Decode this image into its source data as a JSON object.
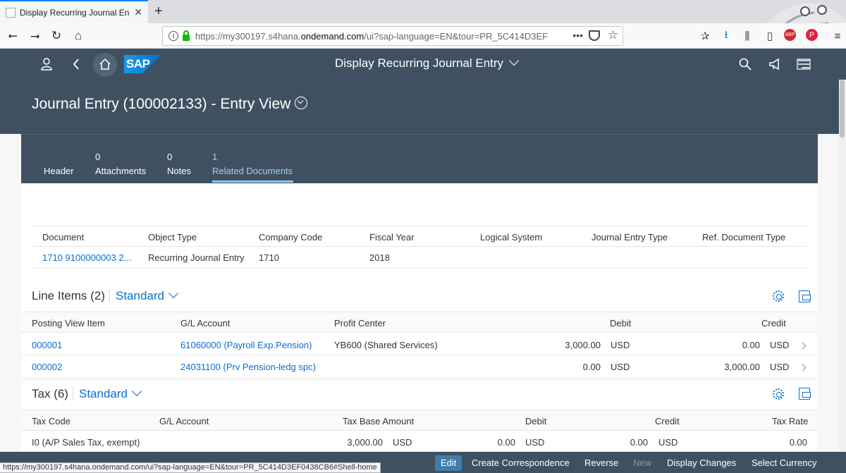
{
  "browser": {
    "tab_title": "Display Recurring Journal Entry",
    "url_prefix": "https://my300197.s4hana.",
    "url_domain": "ondemand.com",
    "url_suffix": "/ui?sap-language=EN&tour=PR_5C414D3EF",
    "status_url": "https://my300197.s4hana.ondemand.com/ui?sap-language=EN&tour=PR_5C414D3EF0438CB6#Shell-home",
    "more_glyph": "•••"
  },
  "shell": {
    "logo": "SAP",
    "title": "Display Recurring Journal Entry"
  },
  "object_header": {
    "title": "Journal Entry (100002133) - Entry View"
  },
  "icon_tabs": [
    {
      "count": "",
      "label": "Header"
    },
    {
      "count": "0",
      "label": "Attachments"
    },
    {
      "count": "0",
      "label": "Notes"
    },
    {
      "count": "1",
      "label": "Related Documents"
    }
  ],
  "related_documents": {
    "columns": [
      "Document",
      "Object Type",
      "Company Code",
      "Fiscal Year",
      "Logical System",
      "Journal Entry Type",
      "Ref. Document Type"
    ],
    "rows": [
      {
        "document": "1710 9100000003 2...",
        "object_type": "Recurring Journal Entry",
        "company_code": "1710",
        "fiscal_year": "2018",
        "logical_system": "",
        "journal_entry_type": "",
        "ref_document_type": ""
      }
    ]
  },
  "line_items": {
    "title": "Line Items (2)",
    "variant": "Standard",
    "columns": [
      "Posting View Item",
      "G/L Account",
      "Profit Center",
      "Debit",
      "Credit"
    ],
    "rows": [
      {
        "item": "000001",
        "gl_account": "61060000 (Payroll Exp.Pension)",
        "profit_center": "YB600 (Shared Services)",
        "debit": "3,000.00",
        "debit_cur": "USD",
        "credit": "0.00",
        "credit_cur": "USD"
      },
      {
        "item": "000002",
        "gl_account": "24031100 (Prv Pension-ledg spc)",
        "profit_center": "",
        "debit": "0.00",
        "debit_cur": "USD",
        "credit": "3,000.00",
        "credit_cur": "USD"
      }
    ]
  },
  "tax": {
    "title": "Tax (6)",
    "variant": "Standard",
    "columns": [
      "Tax Code",
      "G/L Account",
      "Tax Base Amount",
      "Debit",
      "Credit",
      "Tax Rate"
    ],
    "rows": [
      {
        "tax_code": "I0 (A/P Sales Tax, exempt)",
        "gl_account": "",
        "base": "3,000.00",
        "base_cur": "USD",
        "debit": "0.00",
        "debit_cur": "USD",
        "credit": "0.00",
        "credit_cur": "USD",
        "rate": "0.00"
      }
    ]
  },
  "footer": {
    "edit": "Edit",
    "create_correspondence": "Create Correspondence",
    "reverse": "Reverse",
    "new": "New",
    "display_changes": "Display Changes",
    "select_currency": "Select Currency"
  },
  "colors": {
    "shell": "#3f5161",
    "link": "#0a6ed1",
    "active_tab": "#a6cdee"
  }
}
